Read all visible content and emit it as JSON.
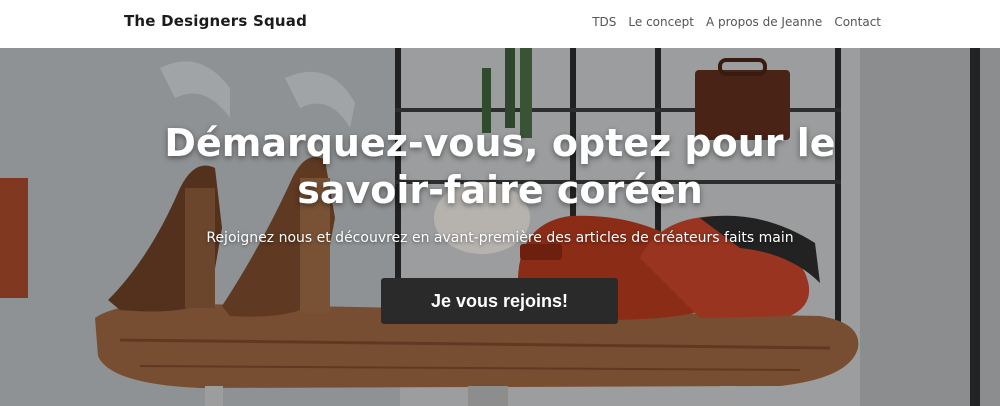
{
  "header": {
    "brand": "The Designers Squad",
    "nav": [
      "TDS",
      "Le concept",
      "A propos de Jeanne",
      "Contact"
    ]
  },
  "hero": {
    "headline_line1": "Démarquez-vous, optez pour le",
    "headline_line2": "savoir-faire coréen",
    "subtitle": "Rejoignez nous et découvrez en avant-première des articles de créateurs faits main",
    "cta_label": "Je vous rejoins!"
  },
  "colors": {
    "header_bg": "#ffffff",
    "cta_bg": "#2a2a2a",
    "text_on_hero": "#ffffff"
  }
}
